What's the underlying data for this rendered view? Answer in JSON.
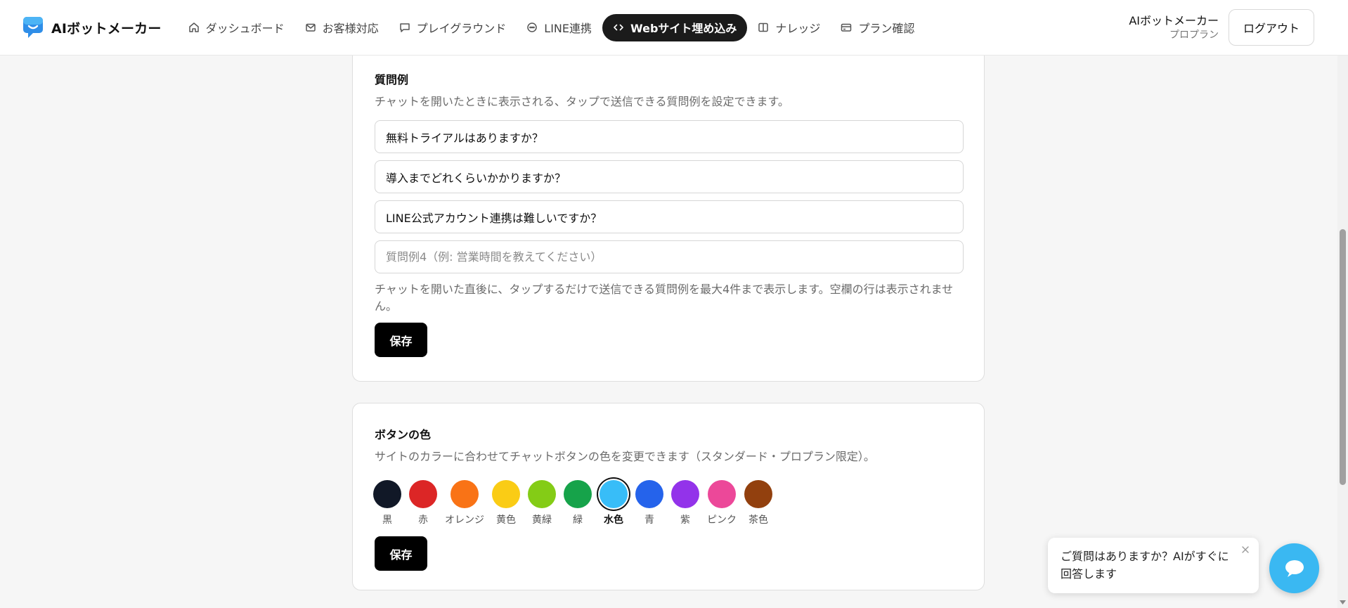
{
  "header": {
    "brand_name": "AIボットメーカー",
    "nav": [
      {
        "label": "ダッシュボード",
        "icon": "home-icon"
      },
      {
        "label": "お客様対応",
        "icon": "mail-icon"
      },
      {
        "label": "プレイグラウンド",
        "icon": "chat-bubble-icon"
      },
      {
        "label": "LINE連携",
        "icon": "line-icon"
      },
      {
        "label": "Webサイト埋め込み",
        "icon": "code-icon",
        "active": true
      },
      {
        "label": "ナレッジ",
        "icon": "book-icon"
      },
      {
        "label": "プラン確認",
        "icon": "credit-card-icon"
      }
    ],
    "user_name": "AIボットメーカー",
    "user_plan": "プロプラン",
    "logout_label": "ログアウト"
  },
  "questions_card": {
    "title": "質問例",
    "description": "チャットを開いたときに表示される、タップで送信できる質問例を設定できます。",
    "inputs": [
      {
        "value": "無料トライアルはありますか？",
        "placeholder": ""
      },
      {
        "value": "導入までどれくらいかかりますか？",
        "placeholder": ""
      },
      {
        "value": "LINE公式アカウント連携は難しいですか？",
        "placeholder": ""
      },
      {
        "value": "",
        "placeholder": "質問例4（例: 営業時間を教えてください）"
      }
    ],
    "help_text": "チャットを開いた直後に、タップするだけで送信できる質問例を最大4件まで表示します。空欄の行は表示されません。",
    "save_label": "保存"
  },
  "color_card": {
    "title": "ボタンの色",
    "description": "サイトのカラーに合わせてチャットボタンの色を変更できます（スタンダード・プロプラン限定）。",
    "colors": [
      {
        "label": "黒",
        "hex": "#111827"
      },
      {
        "label": "赤",
        "hex": "#dc2626"
      },
      {
        "label": "オレンジ",
        "hex": "#f97316"
      },
      {
        "label": "黄色",
        "hex": "#facc15"
      },
      {
        "label": "黄緑",
        "hex": "#84cc16"
      },
      {
        "label": "緑",
        "hex": "#16a34a"
      },
      {
        "label": "水色",
        "hex": "#38bdf8",
        "selected": true
      },
      {
        "label": "青",
        "hex": "#2563eb"
      },
      {
        "label": "紫",
        "hex": "#9333ea"
      },
      {
        "label": "ピンク",
        "hex": "#ec4899"
      },
      {
        "label": "茶色",
        "hex": "#92400e"
      }
    ],
    "save_label": "保存"
  },
  "chat_widget": {
    "bubble_text": "ご質問はありますか？AIがすぐに回答します",
    "launcher_color": "#3ab8f2",
    "icon": "chat-icon"
  },
  "colors": {
    "active_nav_bg": "#1b1b1b",
    "primary_button": "#000000",
    "page_bg": "#f6f6f6"
  }
}
